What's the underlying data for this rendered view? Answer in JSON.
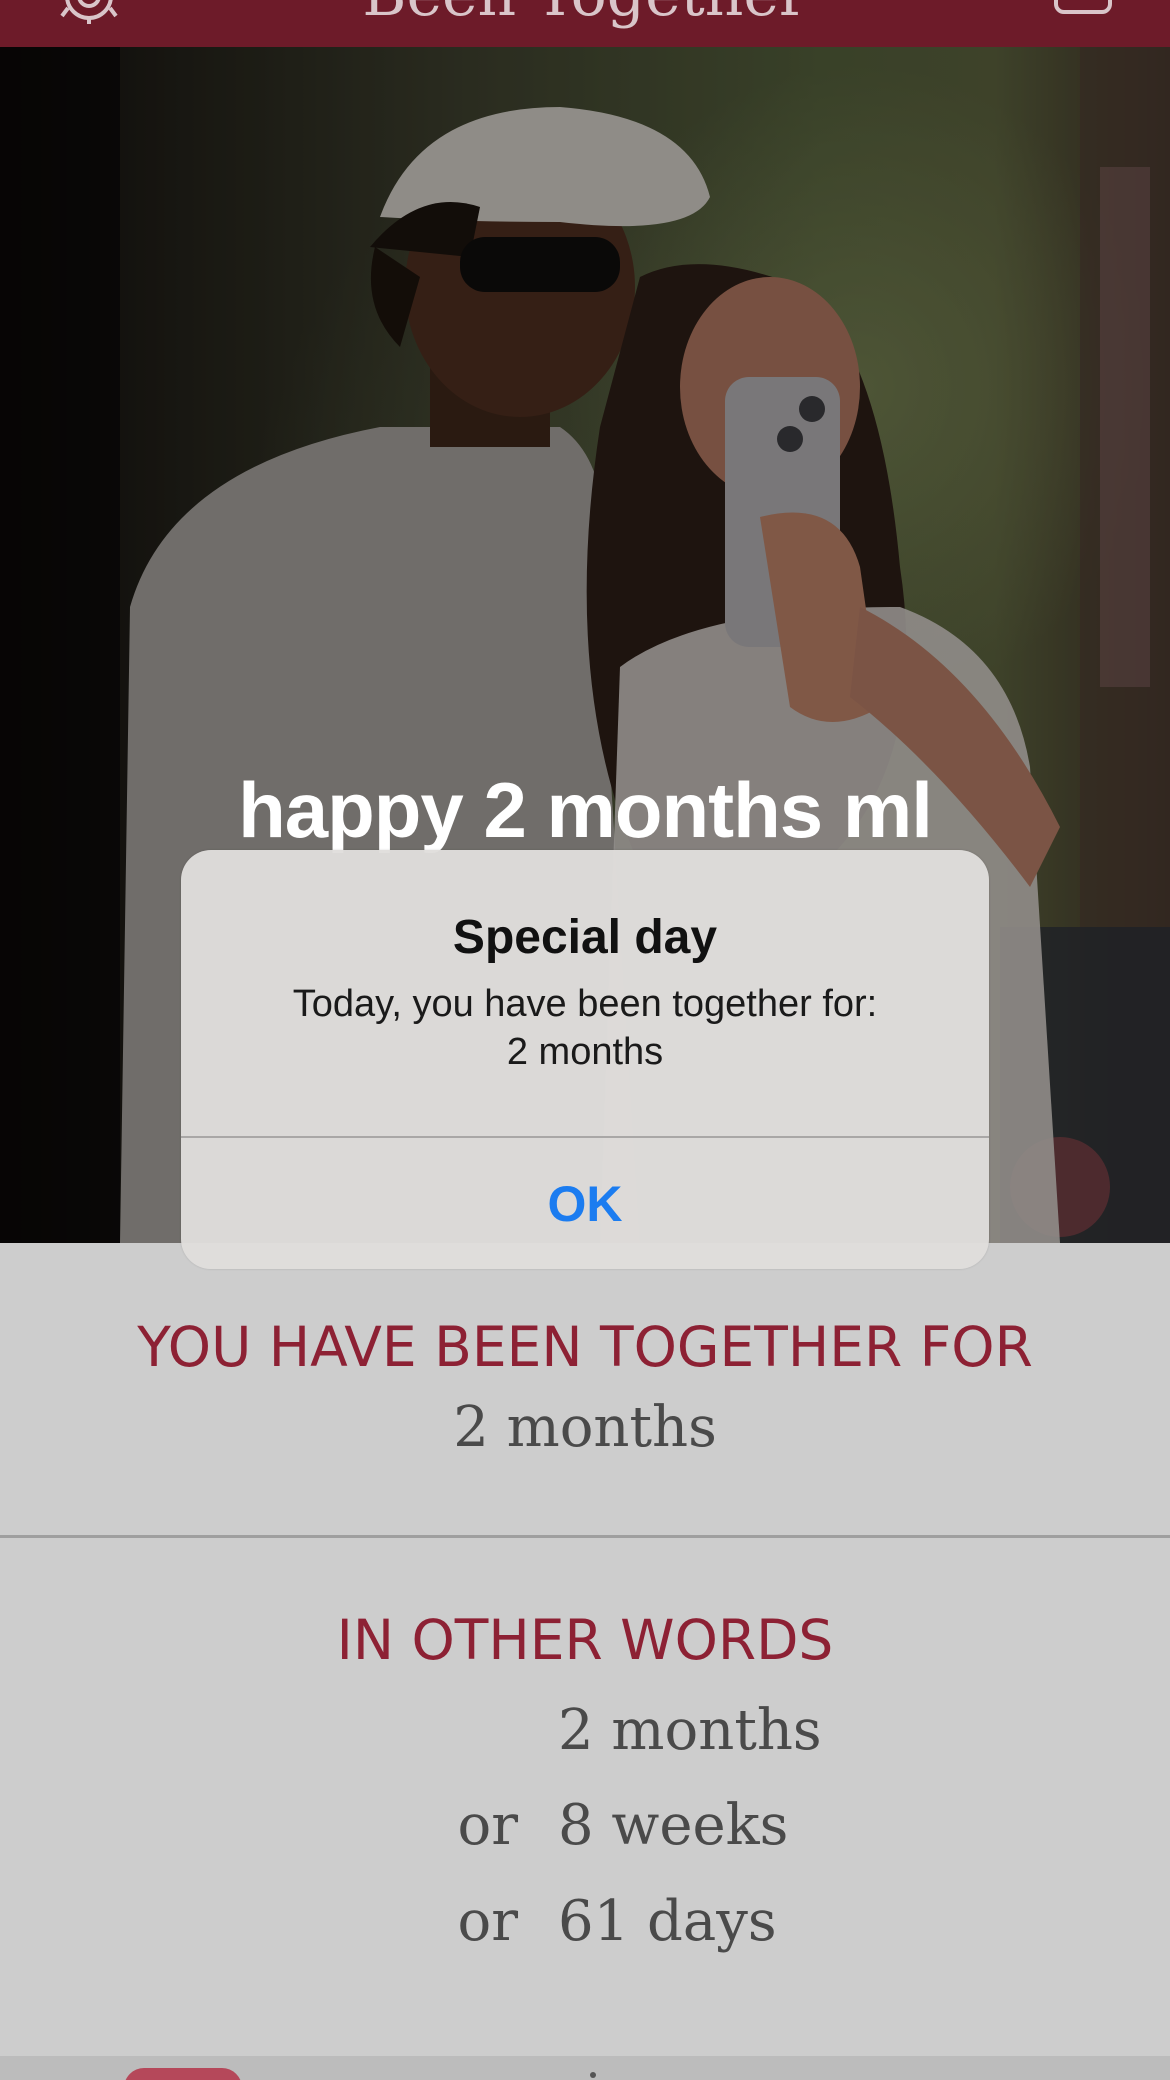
{
  "header": {
    "title": "Been Together",
    "icons": {
      "left": "gear-icon",
      "right": "photo-frame-icon"
    },
    "color": "#6d1b29"
  },
  "photo": {
    "caption": "happy 2 months ml"
  },
  "together": {
    "heading": "YOU HAVE BEEN TOGETHER FOR",
    "value": "2 months"
  },
  "other_words": {
    "heading": "IN OTHER WORDS",
    "rows": [
      {
        "prefix": "",
        "value": "2 months"
      },
      {
        "prefix": "or",
        "value": "8 weeks"
      },
      {
        "prefix": "or",
        "value": "61 days"
      }
    ]
  },
  "alert": {
    "title": "Special day",
    "message_line1": "Today, you have been together for:",
    "message_line2": "2 months",
    "ok_label": "OK"
  },
  "colors": {
    "accent": "#8d2134",
    "link_blue": "#1b7cf0",
    "background": "#cdcdcd"
  }
}
